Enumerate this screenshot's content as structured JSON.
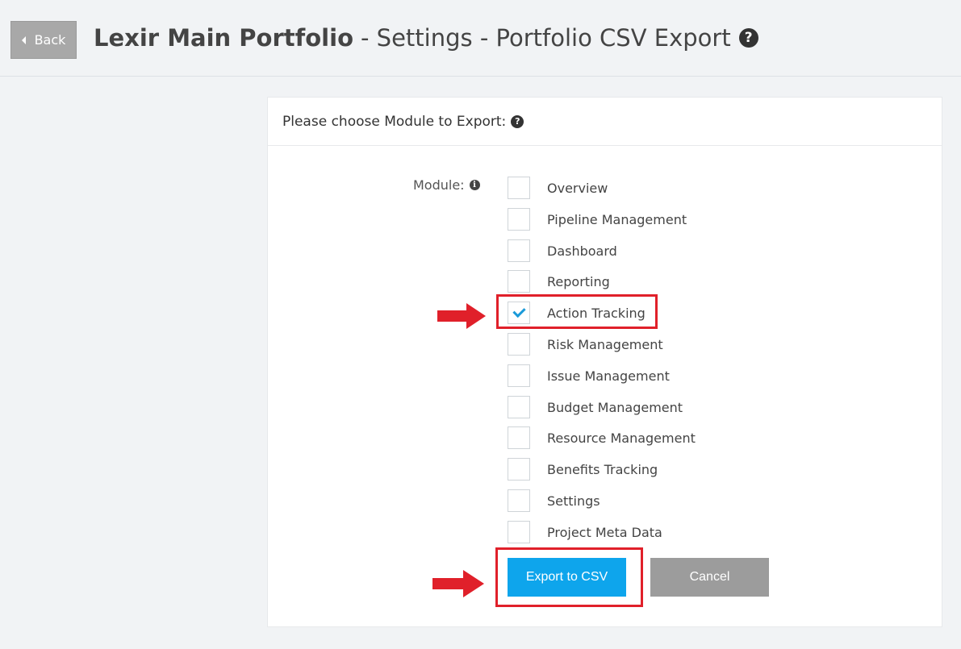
{
  "header": {
    "back_label": "Back",
    "title_bold": "Lexir Main Portfolio",
    "title_rest": "- Settings - Portfolio CSV Export",
    "help_glyph": "?"
  },
  "card": {
    "heading": "Please choose Module to Export:",
    "help_glyph": "?",
    "module_label": "Module:",
    "info_glyph": "i",
    "modules": [
      {
        "label": "Overview",
        "checked": false
      },
      {
        "label": "Pipeline Management",
        "checked": false
      },
      {
        "label": "Dashboard",
        "checked": false
      },
      {
        "label": "Reporting",
        "checked": false
      },
      {
        "label": "Action Tracking",
        "checked": true
      },
      {
        "label": "Risk Management",
        "checked": false
      },
      {
        "label": "Issue Management",
        "checked": false
      },
      {
        "label": "Budget Management",
        "checked": false
      },
      {
        "label": "Resource Management",
        "checked": false
      },
      {
        "label": "Benefits Tracking",
        "checked": false
      },
      {
        "label": "Settings",
        "checked": false
      },
      {
        "label": "Project Meta Data",
        "checked": false
      }
    ],
    "export_label": "Export to CSV",
    "cancel_label": "Cancel"
  },
  "colors": {
    "accent": "#0ea5ec",
    "highlight": "#e0202a",
    "cancel": "#9c9c9c",
    "back": "#a8a8a8"
  },
  "icons": [
    "caret-left-icon",
    "question-circle-icon",
    "info-circle-icon",
    "check-icon",
    "red-arrow-icon"
  ]
}
